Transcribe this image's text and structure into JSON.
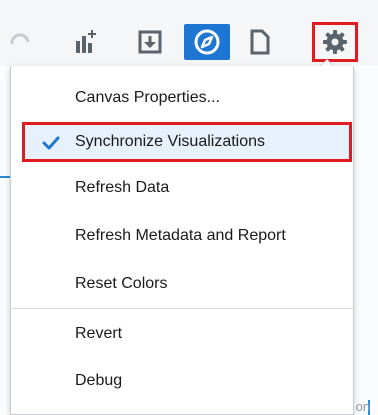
{
  "toolbar": {
    "icons": [
      "undo-icon",
      "add-visualization-icon",
      "export-icon",
      "navigate-icon",
      "new-page-icon",
      "gear-icon"
    ],
    "accent_color": "#1f76d2",
    "highlight_color": "#e01b22"
  },
  "menu": {
    "items": [
      {
        "label": "Canvas Properties..."
      },
      {
        "label": "Synchronize Visualizations",
        "checked": true
      },
      {
        "label": "Refresh Data"
      },
      {
        "label": "Refresh Metadata and Report"
      },
      {
        "label": "Reset Colors"
      },
      {
        "label": "Revert"
      },
      {
        "label": "Debug"
      }
    ]
  },
  "background": {
    "partial_text": "rer name on"
  }
}
